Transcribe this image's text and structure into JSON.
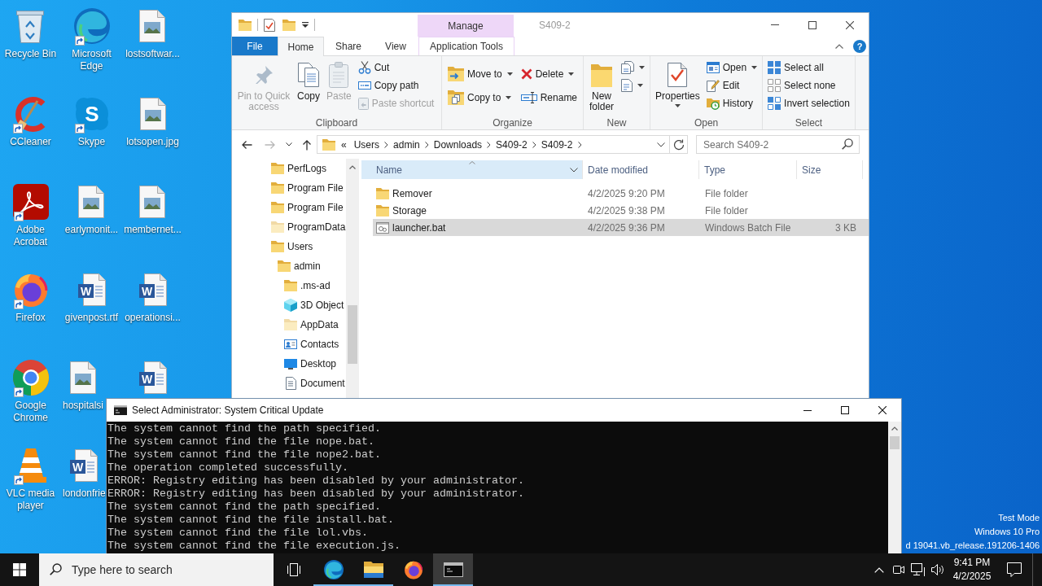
{
  "desktop": {
    "icons": [
      {
        "label": "Recycle Bin",
        "shortcut": false
      },
      {
        "label": "Microsoft Edge",
        "shortcut": true
      },
      {
        "label": "lostsoftwar...",
        "shortcut": false
      },
      {
        "label": "CCleaner",
        "shortcut": true
      },
      {
        "label": "Skype",
        "shortcut": true,
        "logo_letter": "S"
      },
      {
        "label": "lotsopen.jpg",
        "shortcut": false
      },
      {
        "label": "Adobe Acrobat",
        "shortcut": true
      },
      {
        "label": "earlymonit...",
        "shortcut": false
      },
      {
        "label": "membernet...",
        "shortcut": false
      },
      {
        "label": "Firefox",
        "shortcut": true
      },
      {
        "label": "givenpost.rtf",
        "shortcut": false,
        "logo_letter": "W"
      },
      {
        "label": "operationsi...",
        "shortcut": false,
        "logo_letter": "W"
      },
      {
        "label": "Google Chrome",
        "shortcut": true
      },
      {
        "label": "hospitalsi",
        "shortcut": false
      },
      {
        "shortcut": false,
        "logo_letter": "W"
      },
      {
        "label": "VLC media player",
        "shortcut": true
      },
      {
        "label": "londonfrie",
        "shortcut": false,
        "logo_letter": "W"
      }
    ],
    "system_notice": [
      "Test Mode",
      "Windows 10 Pro",
      "d 19041.vb_release.191206-1406"
    ]
  },
  "explorer": {
    "context_header": "Manage",
    "title": "S409-2",
    "help_label": "?",
    "tabs": [
      {
        "label": "File",
        "kind": "file",
        "selected": false
      },
      {
        "label": "Home",
        "kind": "tab",
        "selected": true
      },
      {
        "label": "Share",
        "kind": "tab",
        "selected": false
      },
      {
        "label": "View",
        "kind": "tab",
        "selected": false
      },
      {
        "label": "Application Tools",
        "kind": "context",
        "selected": false
      }
    ],
    "ribbon": [
      {
        "name": "Clipboard",
        "buttons": [
          {
            "label": "Pin to Quick access",
            "kind": "large",
            "disabled": true,
            "dropdown": false
          },
          {
            "label": "Copy",
            "kind": "large",
            "disabled": false,
            "dropdown": false
          },
          {
            "label": "Paste",
            "kind": "large",
            "disabled": true,
            "dropdown": false
          },
          {
            "label": "Cut",
            "kind": "small",
            "disabled": false,
            "dropdown": false
          },
          {
            "label": "Copy path",
            "kind": "small",
            "disabled": false,
            "dropdown": false
          },
          {
            "label": "Paste shortcut",
            "kind": "small",
            "disabled": true,
            "dropdown": false
          }
        ]
      },
      {
        "name": "Organize",
        "buttons": [
          {
            "label": "Move to",
            "kind": "medium",
            "disabled": false,
            "dropdown": true
          },
          {
            "label": "Copy to",
            "kind": "medium",
            "disabled": false,
            "dropdown": true
          },
          {
            "label": "Delete",
            "kind": "medium",
            "disabled": false,
            "dropdown": true
          },
          {
            "label": "Rename",
            "kind": "medium",
            "disabled": false,
            "dropdown": false
          }
        ]
      },
      {
        "name": "New",
        "buttons": [
          {
            "label": "New folder",
            "kind": "large",
            "disabled": false,
            "dropdown": false
          },
          {
            "kind": "small",
            "disabled": false,
            "dropdown": true
          },
          {
            "kind": "small",
            "disabled": false,
            "dropdown": true
          }
        ]
      },
      {
        "name": "Open",
        "buttons": [
          {
            "label": "Properties",
            "kind": "large",
            "disabled": false,
            "dropdown": true
          },
          {
            "label": "Open",
            "kind": "small",
            "disabled": false,
            "dropdown": true
          },
          {
            "label": "Edit",
            "kind": "small",
            "disabled": false,
            "dropdown": false
          },
          {
            "label": "History",
            "kind": "small",
            "disabled": false,
            "dropdown": false
          }
        ]
      },
      {
        "name": "Select",
        "buttons": [
          {
            "label": "Select all",
            "kind": "small",
            "disabled": false,
            "dropdown": false
          },
          {
            "label": "Select none",
            "kind": "small",
            "disabled": false,
            "dropdown": false
          },
          {
            "label": "Invert selection",
            "kind": "small",
            "disabled": false,
            "dropdown": false
          }
        ]
      }
    ],
    "history_buttons": [
      {
        "disabled": false
      },
      {
        "disabled": true
      },
      {
        "disabled": false
      },
      {
        "disabled": false
      }
    ],
    "address": {
      "overflow": "«",
      "crumbs": [
        "Users",
        "admin",
        "Downloads",
        "S409-2",
        "S409-2"
      ]
    },
    "search": {
      "placeholder": "Search S409-2"
    },
    "nav": [
      {
        "label": "PerfLogs",
        "kind": "folder",
        "hidden": false
      },
      {
        "label": "Program File",
        "kind": "folder",
        "hidden": false
      },
      {
        "label": "Program File",
        "kind": "folder",
        "hidden": false
      },
      {
        "label": "ProgramData",
        "kind": "folder",
        "hidden": true
      },
      {
        "label": "Users",
        "kind": "folder",
        "hidden": false,
        "children": [
          {
            "label": "admin",
            "kind": "folder",
            "hidden": false,
            "children": [
              {
                "label": ".ms-ad",
                "kind": "folder",
                "hidden": false
              },
              {
                "label": "3D Object",
                "kind": "objects",
                "hidden": false
              },
              {
                "label": "AppData",
                "kind": "folder",
                "hidden": true
              },
              {
                "label": "Contacts",
                "kind": "contacts",
                "hidden": false
              },
              {
                "label": "Desktop",
                "kind": "desktop",
                "hidden": false
              },
              {
                "label": "Document",
                "kind": "documents",
                "hidden": false
              }
            ]
          }
        ]
      }
    ],
    "columns": [
      {
        "label": "Name",
        "sorted": true,
        "hovered": true
      },
      {
        "label": "Date modified",
        "sorted": false,
        "hovered": false
      },
      {
        "label": "Type",
        "sorted": false,
        "hovered": false
      },
      {
        "label": "Size",
        "sorted": false,
        "hovered": false
      }
    ],
    "files": [
      {
        "name": "Remover",
        "kind": "folder",
        "date": "4/2/2025 9:20 PM",
        "type": "File folder",
        "selected": false
      },
      {
        "name": "Storage",
        "kind": "folder",
        "date": "4/2/2025 9:38 PM",
        "type": "File folder",
        "selected": false
      },
      {
        "name": "launcher.bat",
        "kind": "batch",
        "date": "4/2/2025 9:36 PM",
        "type": "Windows Batch File",
        "size": "3 KB",
        "selected": true
      }
    ]
  },
  "console": {
    "title": "Select Administrator: System Critical Update",
    "lines": [
      "The system cannot find the path specified.",
      "The system cannot find the file nope.bat.",
      "The system cannot find the file nope2.bat.",
      "The operation completed successfully.",
      "ERROR: Registry editing has been disabled by your administrator.",
      "ERROR: Registry editing has been disabled by your administrator.",
      "The system cannot find the path specified.",
      "The system cannot find the file install.bat.",
      "The system cannot find the file lol.vbs.",
      "The system cannot find the file execution.js."
    ]
  },
  "taskbar": {
    "search": {
      "placeholder": "Type here to search"
    },
    "buttons": [
      {
        "active": false,
        "running": false
      },
      {
        "active": false,
        "running": true
      },
      {
        "active": false,
        "running": true
      },
      {
        "active": false,
        "running": false
      },
      {
        "active": true,
        "running": true
      }
    ],
    "clock": {
      "time": "9:41 PM",
      "date": "4/2/2025"
    }
  }
}
